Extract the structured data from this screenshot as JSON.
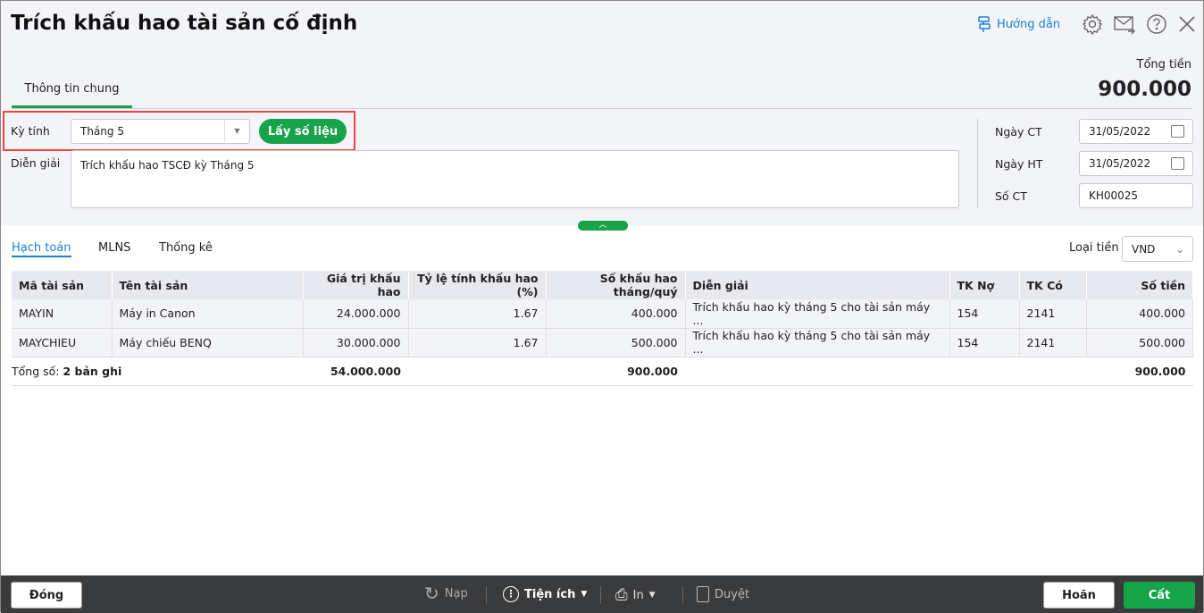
{
  "header": {
    "title": "Trích khấu hao tài sản cố định",
    "guide_label": "Hướng dẫn",
    "total_label": "Tổng tiền",
    "total_value": "900.000"
  },
  "tabs": [
    {
      "label": "Thông tin chung",
      "active": true
    }
  ],
  "form": {
    "period_label": "Kỳ tính",
    "period_value": "Tháng 5",
    "fetch_button": "Lấy số liệu",
    "desc_label": "Diễn giải",
    "desc_value": "Trích khấu hao TSCĐ kỳ Tháng 5",
    "voucher_date_label": "Ngày CT",
    "voucher_date": "31/05/2022",
    "post_date_label": "Ngày HT",
    "post_date": "31/05/2022",
    "voucher_no_label": "Số CT",
    "voucher_no": "KH00025"
  },
  "detail_tabs": [
    "Hạch toán",
    "MLNS",
    "Thống kê"
  ],
  "currency": {
    "label": "Loại tiền",
    "value": "VND"
  },
  "table": {
    "columns": [
      "Mã tài sản",
      "Tên tài sản",
      "Giá trị khấu hao",
      "Tỷ lệ tính khấu hao (%)",
      "Số khấu hao tháng/quý",
      "Diễn giải",
      "TK Nợ",
      "TK Có",
      "Số tiền"
    ],
    "rows": [
      [
        "MAYIN",
        "Máy in Canon",
        "24.000.000",
        "1.67",
        "400.000",
        "Trích khấu hao kỳ tháng 5 cho tài sản máy ...",
        "154",
        "2141",
        "400.000"
      ],
      [
        "MAYCHIEU",
        "Máy chiếu BENQ",
        "30.000.000",
        "1.67",
        "500.000",
        "Trích khấu hao kỳ tháng 5 cho tài sản máy ...",
        "154",
        "2141",
        "500.000"
      ]
    ],
    "total_prefix": "Tổng số: ",
    "total_count": "2 bản ghi",
    "total_value": "54.000.000",
    "total_depr": "900.000",
    "total_amount": "900.000"
  },
  "footer": {
    "close": "Đóng",
    "reload": "Nạp",
    "utilities": "Tiện ích",
    "print": "In",
    "approve": "Duyệt",
    "cancel": "Hoãn",
    "save": "Cất"
  },
  "colors": {
    "accent": "#16a34a",
    "link": "#1a7fd6",
    "highlight": "#ef4444"
  }
}
